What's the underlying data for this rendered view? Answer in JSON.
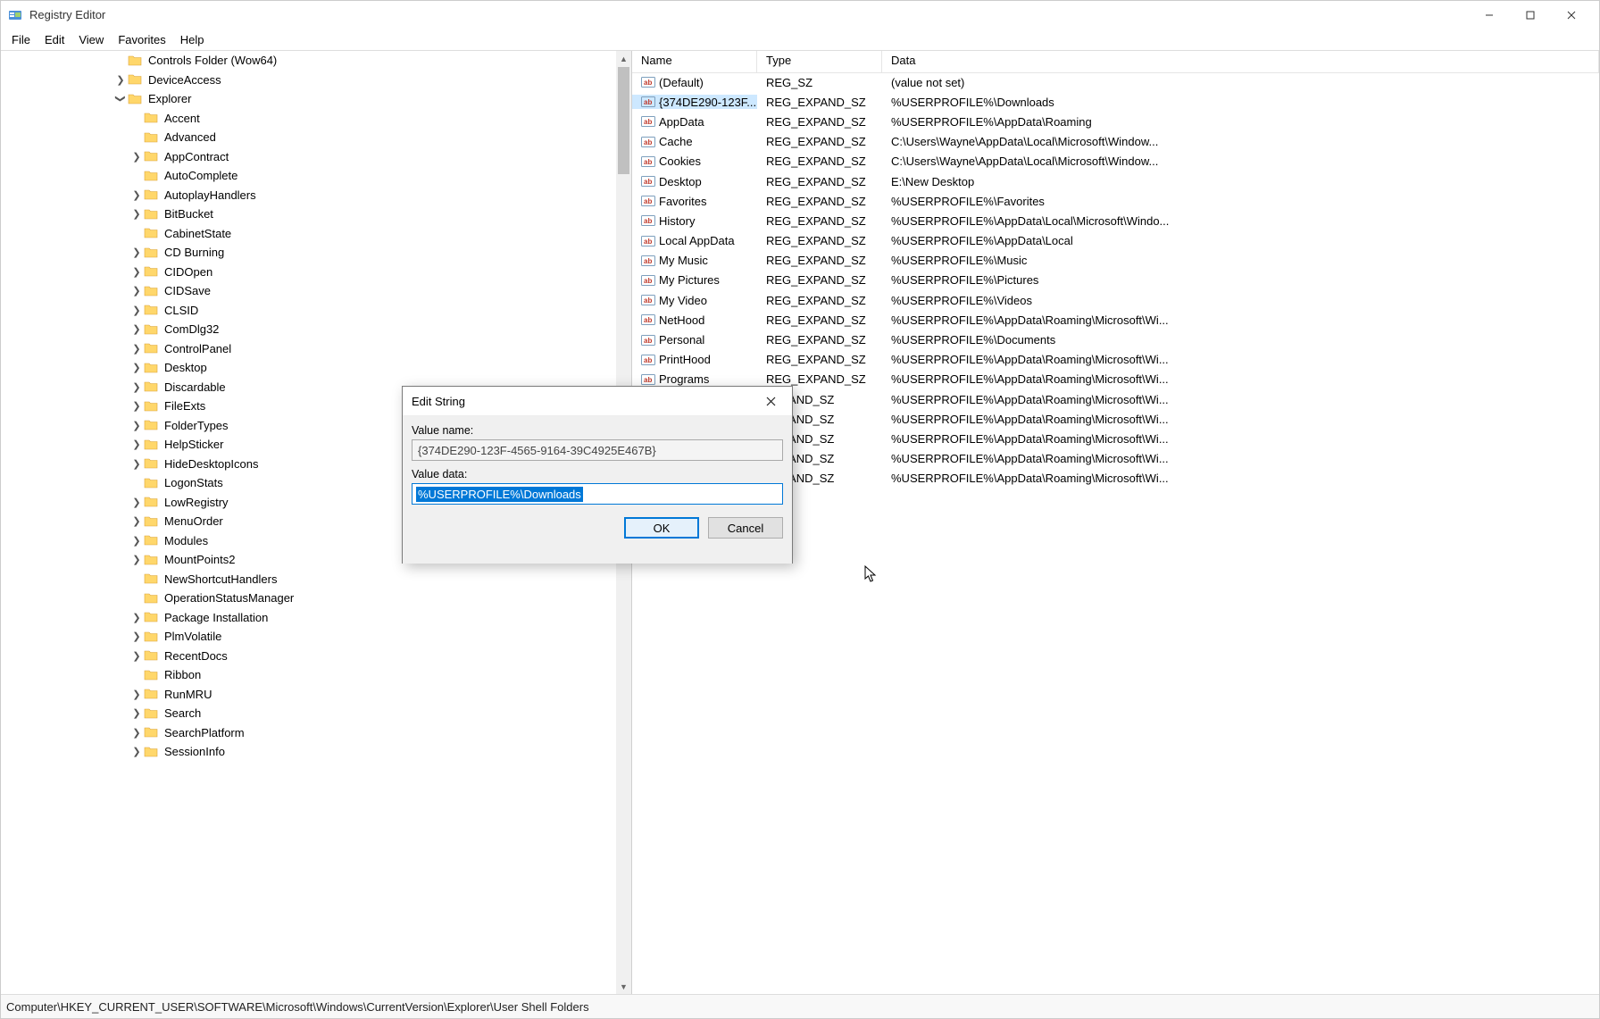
{
  "app": {
    "title": "Registry Editor"
  },
  "menu": [
    "File",
    "Edit",
    "View",
    "Favorites",
    "Help"
  ],
  "columns": {
    "name": "Name",
    "type": "Type",
    "data": "Data"
  },
  "status": "Computer\\HKEY_CURRENT_USER\\SOFTWARE\\Microsoft\\Windows\\CurrentVersion\\Explorer\\User Shell Folders",
  "tree": [
    {
      "indent": 7,
      "exp": "",
      "label": "Controls Folder (Wow64)"
    },
    {
      "indent": 7,
      "exp": ">",
      "label": "DeviceAccess"
    },
    {
      "indent": 7,
      "exp": "v",
      "label": "Explorer"
    },
    {
      "indent": 8,
      "exp": "",
      "label": "Accent"
    },
    {
      "indent": 8,
      "exp": "",
      "label": "Advanced"
    },
    {
      "indent": 8,
      "exp": ">",
      "label": "AppContract"
    },
    {
      "indent": 8,
      "exp": "",
      "label": "AutoComplete"
    },
    {
      "indent": 8,
      "exp": ">",
      "label": "AutoplayHandlers"
    },
    {
      "indent": 8,
      "exp": ">",
      "label": "BitBucket"
    },
    {
      "indent": 8,
      "exp": "",
      "label": "CabinetState"
    },
    {
      "indent": 8,
      "exp": ">",
      "label": "CD Burning"
    },
    {
      "indent": 8,
      "exp": ">",
      "label": "CIDOpen"
    },
    {
      "indent": 8,
      "exp": ">",
      "label": "CIDSave"
    },
    {
      "indent": 8,
      "exp": ">",
      "label": "CLSID"
    },
    {
      "indent": 8,
      "exp": ">",
      "label": "ComDlg32"
    },
    {
      "indent": 8,
      "exp": ">",
      "label": "ControlPanel"
    },
    {
      "indent": 8,
      "exp": ">",
      "label": "Desktop"
    },
    {
      "indent": 8,
      "exp": ">",
      "label": "Discardable"
    },
    {
      "indent": 8,
      "exp": ">",
      "label": "FileExts"
    },
    {
      "indent": 8,
      "exp": ">",
      "label": "FolderTypes"
    },
    {
      "indent": 8,
      "exp": ">",
      "label": "HelpSticker"
    },
    {
      "indent": 8,
      "exp": ">",
      "label": "HideDesktopIcons"
    },
    {
      "indent": 8,
      "exp": "",
      "label": "LogonStats"
    },
    {
      "indent": 8,
      "exp": ">",
      "label": "LowRegistry"
    },
    {
      "indent": 8,
      "exp": ">",
      "label": "MenuOrder"
    },
    {
      "indent": 8,
      "exp": ">",
      "label": "Modules"
    },
    {
      "indent": 8,
      "exp": ">",
      "label": "MountPoints2"
    },
    {
      "indent": 8,
      "exp": "",
      "label": "NewShortcutHandlers"
    },
    {
      "indent": 8,
      "exp": "",
      "label": "OperationStatusManager"
    },
    {
      "indent": 8,
      "exp": ">",
      "label": "Package Installation"
    },
    {
      "indent": 8,
      "exp": ">",
      "label": "PlmVolatile"
    },
    {
      "indent": 8,
      "exp": ">",
      "label": "RecentDocs"
    },
    {
      "indent": 8,
      "exp": "",
      "label": "Ribbon"
    },
    {
      "indent": 8,
      "exp": ">",
      "label": "RunMRU"
    },
    {
      "indent": 8,
      "exp": ">",
      "label": "Search"
    },
    {
      "indent": 8,
      "exp": ">",
      "label": "SearchPlatform"
    },
    {
      "indent": 8,
      "exp": ">",
      "label": "SessionInfo"
    }
  ],
  "values": [
    {
      "name": "(Default)",
      "type": "REG_SZ",
      "data": "(value not set)",
      "sel": false
    },
    {
      "name": "{374DE290-123F...",
      "type": "REG_EXPAND_SZ",
      "data": "%USERPROFILE%\\Downloads",
      "sel": true
    },
    {
      "name": "AppData",
      "type": "REG_EXPAND_SZ",
      "data": "%USERPROFILE%\\AppData\\Roaming",
      "sel": false
    },
    {
      "name": "Cache",
      "type": "REG_EXPAND_SZ",
      "data": "C:\\Users\\Wayne\\AppData\\Local\\Microsoft\\Window...",
      "sel": false
    },
    {
      "name": "Cookies",
      "type": "REG_EXPAND_SZ",
      "data": "C:\\Users\\Wayne\\AppData\\Local\\Microsoft\\Window...",
      "sel": false
    },
    {
      "name": "Desktop",
      "type": "REG_EXPAND_SZ",
      "data": "E:\\New Desktop",
      "sel": false
    },
    {
      "name": "Favorites",
      "type": "REG_EXPAND_SZ",
      "data": "%USERPROFILE%\\Favorites",
      "sel": false
    },
    {
      "name": "History",
      "type": "REG_EXPAND_SZ",
      "data": "%USERPROFILE%\\AppData\\Local\\Microsoft\\Windo...",
      "sel": false
    },
    {
      "name": "Local AppData",
      "type": "REG_EXPAND_SZ",
      "data": "%USERPROFILE%\\AppData\\Local",
      "sel": false
    },
    {
      "name": "My Music",
      "type": "REG_EXPAND_SZ",
      "data": "%USERPROFILE%\\Music",
      "sel": false
    },
    {
      "name": "My Pictures",
      "type": "REG_EXPAND_SZ",
      "data": "%USERPROFILE%\\Pictures",
      "sel": false
    },
    {
      "name": "My Video",
      "type": "REG_EXPAND_SZ",
      "data": "%USERPROFILE%\\Videos",
      "sel": false
    },
    {
      "name": "NetHood",
      "type": "REG_EXPAND_SZ",
      "data": "%USERPROFILE%\\AppData\\Roaming\\Microsoft\\Wi...",
      "sel": false
    },
    {
      "name": "Personal",
      "type": "REG_EXPAND_SZ",
      "data": "%USERPROFILE%\\Documents",
      "sel": false
    },
    {
      "name": "PrintHood",
      "type": "REG_EXPAND_SZ",
      "data": "%USERPROFILE%\\AppData\\Roaming\\Microsoft\\Wi...",
      "sel": false
    },
    {
      "name": "Programs",
      "type": "REG_EXPAND_SZ",
      "data": "%USERPROFILE%\\AppData\\Roaming\\Microsoft\\Wi...",
      "sel": false
    },
    {
      "name": "",
      "type": "EXPAND_SZ",
      "data": "%USERPROFILE%\\AppData\\Roaming\\Microsoft\\Wi...",
      "sel": false
    },
    {
      "name": "",
      "type": "EXPAND_SZ",
      "data": "%USERPROFILE%\\AppData\\Roaming\\Microsoft\\Wi...",
      "sel": false
    },
    {
      "name": "",
      "type": "EXPAND_SZ",
      "data": "%USERPROFILE%\\AppData\\Roaming\\Microsoft\\Wi...",
      "sel": false
    },
    {
      "name": "",
      "type": "EXPAND_SZ",
      "data": "%USERPROFILE%\\AppData\\Roaming\\Microsoft\\Wi...",
      "sel": false
    },
    {
      "name": "",
      "type": "EXPAND_SZ",
      "data": "%USERPROFILE%\\AppData\\Roaming\\Microsoft\\Wi...",
      "sel": false
    }
  ],
  "dialog": {
    "title": "Edit String",
    "name_label": "Value name:",
    "name_value": "{374DE290-123F-4565-9164-39C4925E467B}",
    "data_label": "Value data:",
    "data_value": "%USERPROFILE%\\Downloads",
    "ok": "OK",
    "cancel": "Cancel"
  }
}
